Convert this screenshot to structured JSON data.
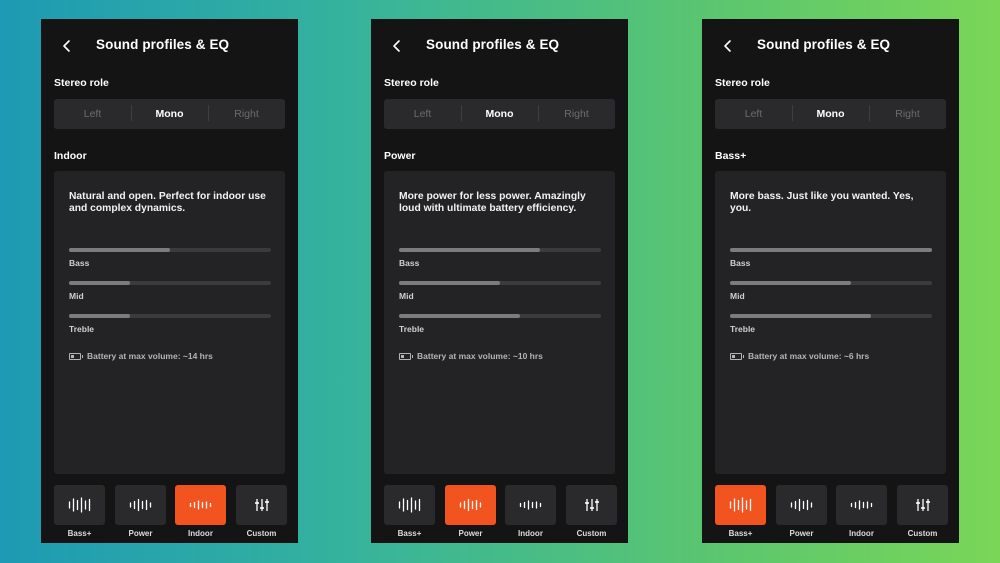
{
  "accent_color": "#f25420",
  "screens": [
    {
      "title": "Sound profiles & EQ",
      "stereo_role_label": "Stereo role",
      "stereo_options": [
        "Left",
        "Mono",
        "Right"
      ],
      "stereo_selected": "Mono",
      "profile_name": "Indoor",
      "description": "Natural and open. Perfect for indoor use and complex dynamics.",
      "bars": [
        {
          "label": "Bass",
          "level": 0.5
        },
        {
          "label": "Mid",
          "level": 0.3
        },
        {
          "label": "Treble",
          "level": 0.3
        }
      ],
      "battery_text": "Battery at max volume: ~14 hrs",
      "tabs": [
        "Bass+",
        "Power",
        "Indoor",
        "Custom"
      ],
      "active_tab": "Indoor"
    },
    {
      "title": "Sound profiles & EQ",
      "stereo_role_label": "Stereo role",
      "stereo_options": [
        "Left",
        "Mono",
        "Right"
      ],
      "stereo_selected": "Mono",
      "profile_name": "Power",
      "description": "More power for less power. Amazingly loud with ultimate battery efficiency.",
      "bars": [
        {
          "label": "Bass",
          "level": 0.7
        },
        {
          "label": "Mid",
          "level": 0.5
        },
        {
          "label": "Treble",
          "level": 0.6
        }
      ],
      "battery_text": "Battery at max volume: ~10 hrs",
      "tabs": [
        "Bass+",
        "Power",
        "Indoor",
        "Custom"
      ],
      "active_tab": "Power"
    },
    {
      "title": "Sound profiles & EQ",
      "stereo_role_label": "Stereo role",
      "stereo_options": [
        "Left",
        "Mono",
        "Right"
      ],
      "stereo_selected": "Mono",
      "profile_name": "Bass+",
      "description": "More bass. Just like you wanted. Yes, you.",
      "bars": [
        {
          "label": "Bass",
          "level": 1.0
        },
        {
          "label": "Mid",
          "level": 0.6
        },
        {
          "label": "Treble",
          "level": 0.7
        }
      ],
      "battery_text": "Battery at max volume: ~6 hrs",
      "tabs": [
        "Bass+",
        "Power",
        "Indoor",
        "Custom"
      ],
      "active_tab": "Bass+"
    }
  ],
  "tab_icons": [
    "bass-plus-waveform-icon",
    "power-waveform-icon",
    "indoor-waveform-icon",
    "custom-eq-sliders-icon"
  ]
}
